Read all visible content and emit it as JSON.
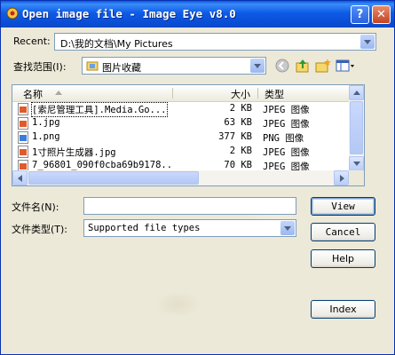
{
  "window": {
    "title": "Open image file - Image Eye v8.0",
    "help_button": "?",
    "close_button": "✕"
  },
  "recent": {
    "label": "Recent:",
    "value": "D:\\我的文档\\My Pictures"
  },
  "look_in": {
    "label": "查找范围(I):",
    "value": "图片收藏"
  },
  "toolbar": {
    "icons": [
      "back-icon",
      "up-folder-icon",
      "new-folder-icon",
      "view-menu-icon"
    ]
  },
  "file_list": {
    "columns": [
      "名称",
      "大小",
      "类型"
    ],
    "rows": [
      {
        "name": "[索尼管理工具].Media.Go...",
        "size": "2 KB",
        "type": "JPEG 图像",
        "icon": "jpeg-icon"
      },
      {
        "name": "1.jpg",
        "size": "63 KB",
        "type": "JPEG 图像",
        "icon": "jpeg-icon"
      },
      {
        "name": "1.png",
        "size": "377 KB",
        "type": "PNG 图像",
        "icon": "png-icon"
      },
      {
        "name": "1寸照片生成器.jpg",
        "size": "2 KB",
        "type": "JPEG 图像",
        "icon": "jpeg-icon"
      },
      {
        "name": "7_96801_090f0cba69b9178...",
        "size": "70 KB",
        "type": "JPEG 图像",
        "icon": "jpeg-icon"
      }
    ]
  },
  "file_name": {
    "label": "文件名(N):",
    "value": ""
  },
  "file_type": {
    "label": "文件类型(T):",
    "value": "Supported file types"
  },
  "buttons": {
    "view": "View",
    "cancel": "Cancel",
    "help": "Help",
    "index": "Index"
  },
  "colors": {
    "titlebar": "#0a4ed6",
    "dialog_bg": "#ece9d8",
    "field_border": "#7f9db9"
  }
}
